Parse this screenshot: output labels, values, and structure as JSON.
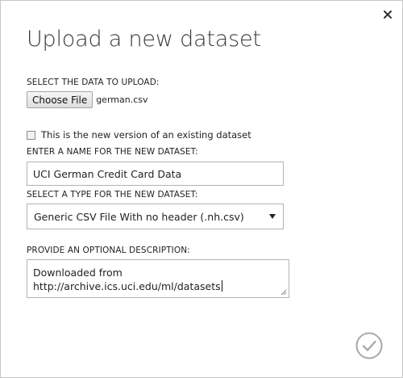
{
  "dialog": {
    "title": "Upload a new dataset",
    "close_icon": "close-icon",
    "ok_icon": "checkmark-circle-icon"
  },
  "upload": {
    "label": "SELECT THE DATA TO UPLOAD:",
    "button_label": "Choose File",
    "file_name": "german.csv"
  },
  "version": {
    "label": "This is the new version of an existing dataset",
    "checked": false
  },
  "name": {
    "label": "ENTER A NAME FOR THE NEW DATASET:",
    "value": "UCI German Credit Card Data"
  },
  "type": {
    "label": "SELECT A TYPE FOR THE NEW DATASET:",
    "selected": "Generic CSV File With no header (.nh.csv)"
  },
  "description": {
    "label": "PROVIDE AN OPTIONAL DESCRIPTION:",
    "line1": "Downloaded from",
    "line2": "http://archive.ics.uci.edu/ml/datasets"
  },
  "colors": {
    "border": "#c6c6c6",
    "input_border": "#b3b3b3",
    "ok_button": "#a8a8a8"
  }
}
